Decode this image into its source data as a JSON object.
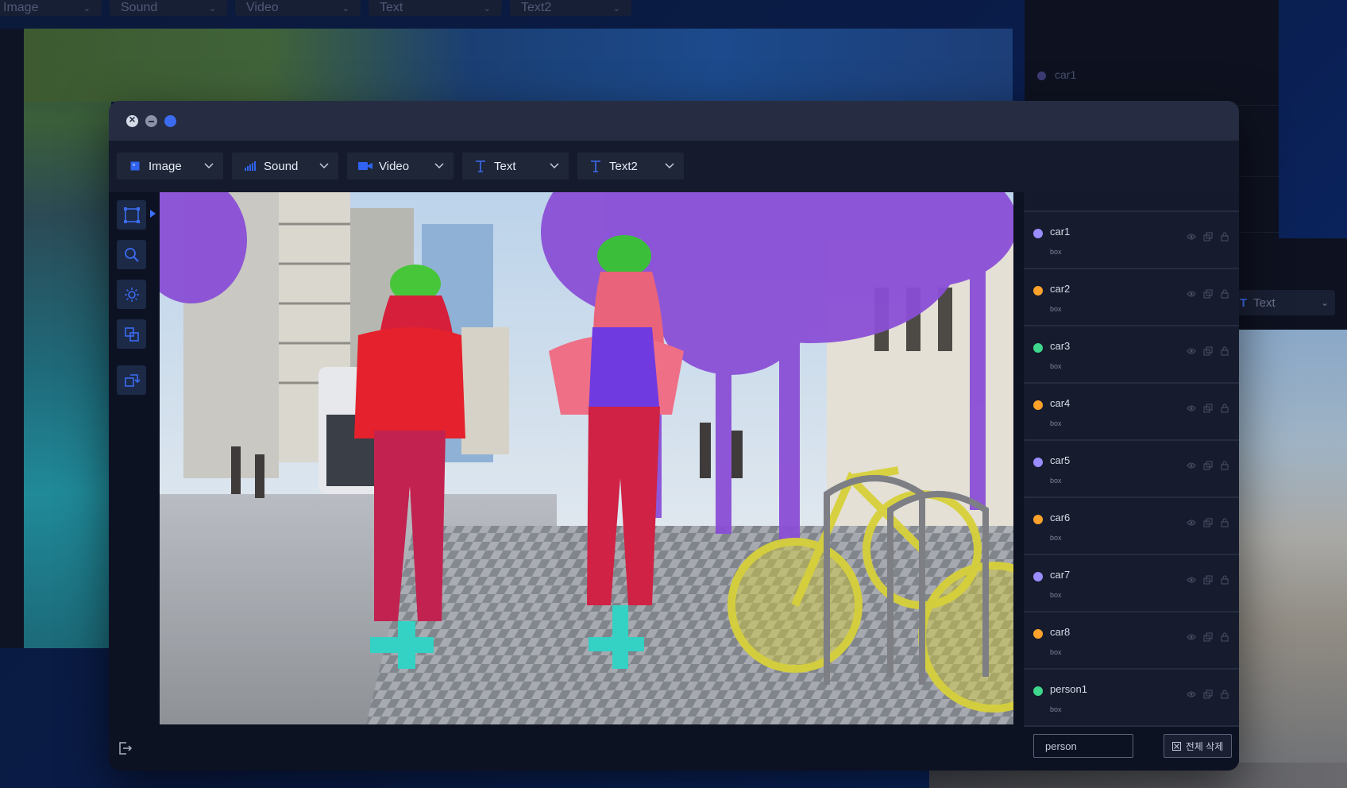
{
  "background": {
    "tabs": [
      {
        "label": "Image"
      },
      {
        "label": "Sound"
      },
      {
        "label": "Video"
      },
      {
        "label": "Text"
      },
      {
        "label": "Text2"
      }
    ],
    "right_list_item": "car1",
    "right_chip_label": "Text"
  },
  "window": {
    "tabs": [
      {
        "label": "Image",
        "icon": "image-icon"
      },
      {
        "label": "Sound",
        "icon": "sound-bars-icon"
      },
      {
        "label": "Video",
        "icon": "video-camera-icon"
      },
      {
        "label": "Text",
        "icon": "text-t-icon"
      },
      {
        "label": "Text2",
        "icon": "text-t-icon"
      }
    ],
    "tools": [
      {
        "icon": "bounding-box-icon",
        "active": true
      },
      {
        "icon": "zoom-icon"
      },
      {
        "icon": "brightness-icon"
      },
      {
        "icon": "layers-copy-icon"
      },
      {
        "icon": "rotate-transform-icon"
      }
    ],
    "objects": [
      {
        "name": "car1",
        "type": "box",
        "color": "#9b8cff"
      },
      {
        "name": "car2",
        "type": "box",
        "color": "#ffa22b"
      },
      {
        "name": "car3",
        "type": "box",
        "color": "#3ed88c"
      },
      {
        "name": "car4",
        "type": "box",
        "color": "#ffa22b"
      },
      {
        "name": "car5",
        "type": "box",
        "color": "#9b8cff"
      },
      {
        "name": "car6",
        "type": "box",
        "color": "#ffa22b"
      },
      {
        "name": "car7",
        "type": "box",
        "color": "#9b8cff"
      },
      {
        "name": "car8",
        "type": "box",
        "color": "#ffa22b"
      },
      {
        "name": "person1",
        "type": "box",
        "color": "#3ed88c"
      }
    ],
    "search_value": "person",
    "clear_all_label": "전체 삭제"
  },
  "colors": {
    "accent": "#3b6cf0",
    "tool_bg": "#1c2947"
  }
}
